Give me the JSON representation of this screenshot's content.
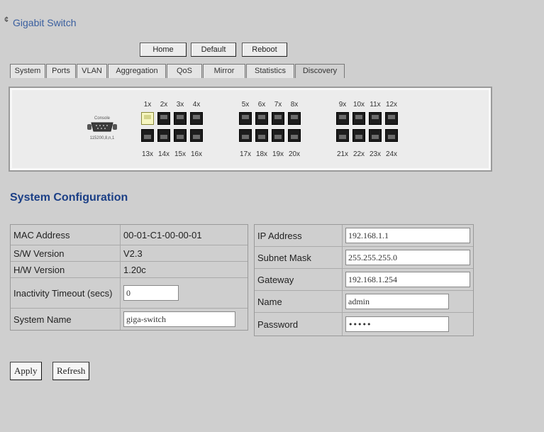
{
  "header": {
    "mark": "¢",
    "title": "Gigabit Switch"
  },
  "toolbar": {
    "home": "Home",
    "default": "Default",
    "reboot": "Reboot"
  },
  "tabs": [
    {
      "label": "System"
    },
    {
      "label": "Ports"
    },
    {
      "label": "VLAN"
    },
    {
      "label": "Aggregation"
    },
    {
      "label": "QoS"
    },
    {
      "label": "Mirror"
    },
    {
      "label": "Statistics"
    },
    {
      "label": "Discovery"
    }
  ],
  "active_tab": "Discovery",
  "switch_panel": {
    "console_label": "Console",
    "console_baud": "115200,8,n,1",
    "port_groups": [
      {
        "top": [
          "1x",
          "2x",
          "3x",
          "4x"
        ],
        "bottom": [
          "13x",
          "14x",
          "15x",
          "16x"
        ]
      },
      {
        "top": [
          "5x",
          "6x",
          "7x",
          "8x"
        ],
        "bottom": [
          "17x",
          "18x",
          "19x",
          "20x"
        ]
      },
      {
        "top": [
          "9x",
          "10x",
          "11x",
          "12x"
        ],
        "bottom": [
          "21x",
          "22x",
          "23x",
          "24x"
        ]
      }
    ],
    "active_port": "1x"
  },
  "section_title": "System Configuration",
  "config_left": {
    "mac_label": "MAC Address",
    "mac_value": "00-01-C1-00-00-01",
    "sw_label": "S/W Version",
    "sw_value": "V2.3",
    "hw_label": "H/W Version",
    "hw_value": "1.20c",
    "timeout_label": "Inactivity Timeout (secs)",
    "timeout_value": "0",
    "sysname_label": "System Name",
    "sysname_value": "giga-switch"
  },
  "config_right": {
    "ip_label": "IP Address",
    "ip_value": "192.168.1.1",
    "mask_label": "Subnet Mask",
    "mask_value": "255.255.255.0",
    "gw_label": "Gateway",
    "gw_value": "192.168.1.254",
    "name_label": "Name",
    "name_value": "admin",
    "pwd_label": "Password",
    "pwd_value": "•••••"
  },
  "buttons": {
    "apply": "Apply",
    "refresh": "Refresh"
  }
}
